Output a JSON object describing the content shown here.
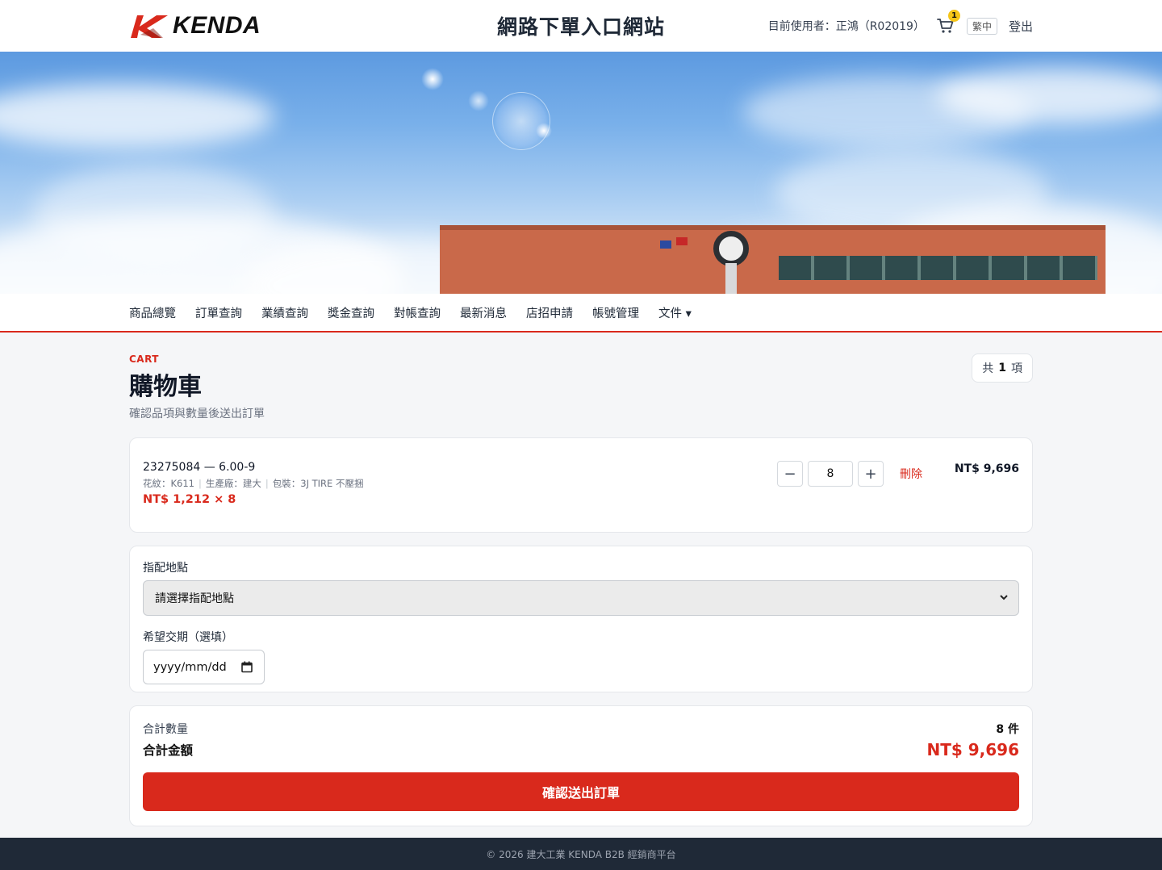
{
  "header": {
    "logo_text": "KENDA",
    "site_title": "網路下單入口網站",
    "user_text": "目前使用者：正鴻（R02019）",
    "cart_count": "1",
    "lang_label": "繁中",
    "logout_label": "登出"
  },
  "nav": {
    "items": [
      "商品總覽",
      "訂單查詢",
      "業績查詢",
      "獎金查詢",
      "對帳查詢",
      "最新消息",
      "店招申請",
      "帳號管理",
      "文件 ▾"
    ]
  },
  "page": {
    "eyebrow": "CART",
    "title": "購物車",
    "subtitle": "確認品項與數量後送出訂單",
    "count_prefix": "共",
    "count_value": "1",
    "count_suffix": "項"
  },
  "cart_item": {
    "code": "23275084 — 6.00-9",
    "pattern": "花紋：K611",
    "factory": "生產廠：建大",
    "packaging": "包裝：3J TIRE 不壓捆",
    "unit_price": "NT$ 1,212 × 8",
    "qty_minus": "−",
    "qty_value": "8",
    "qty_plus": "+",
    "delete_label": "刪除",
    "line_total": "NT$ 9,696"
  },
  "form": {
    "delivery_label": "指配地點",
    "delivery_placeholder": "請選擇指配地點",
    "date_label": "希望交期（選填）",
    "date_placeholder": "yyyy/mm/dd"
  },
  "totals": {
    "qty_label": "合計數量",
    "qty_value": "8 件",
    "amount_label": "合計金額",
    "amount_value": "NT$ 9,696",
    "submit_label": "確認送出訂單"
  },
  "footer": {
    "text": "© 2026 建大工業 KENDA B2B 經銷商平台"
  },
  "colors": {
    "accent": "#d9291c",
    "footer_bg": "#1f2937",
    "badge": "#f5c518"
  }
}
